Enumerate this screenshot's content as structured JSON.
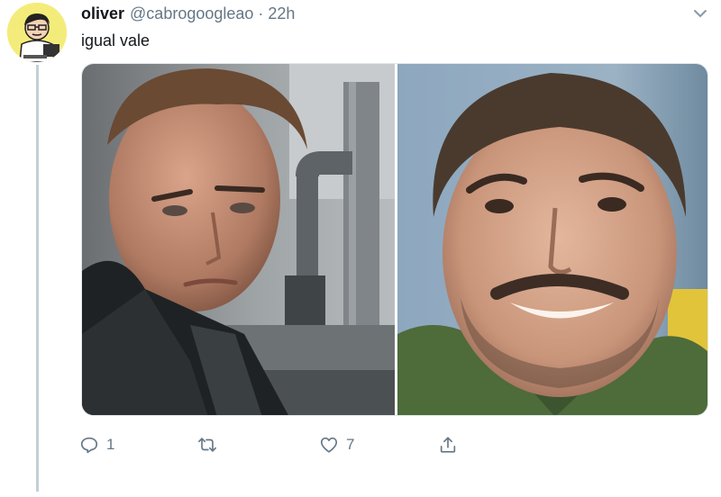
{
  "tweet": {
    "author_name": "oliver",
    "author_handle": "@cabrogoogleao",
    "separator": "·",
    "time": "22h",
    "text": "igual vale"
  },
  "media": {
    "photos": [
      {
        "subject": "man in dark tactical jacket, serious expression, industrial pipes background"
      },
      {
        "subject": "smiling bearded man in green shirt"
      }
    ]
  },
  "actions": {
    "reply_count": "1",
    "retweet_count": "",
    "like_count": "7"
  },
  "icons": {
    "avatar": "cartoon-avatar-icon",
    "caret": "chevron-down-icon",
    "reply": "reply-icon",
    "retweet": "retweet-icon",
    "like": "heart-icon",
    "share": "share-icon"
  },
  "colors": {
    "muted": "#657786",
    "thread_line": "#c4cfd6",
    "avatar_bg": "#f4ec7a"
  }
}
